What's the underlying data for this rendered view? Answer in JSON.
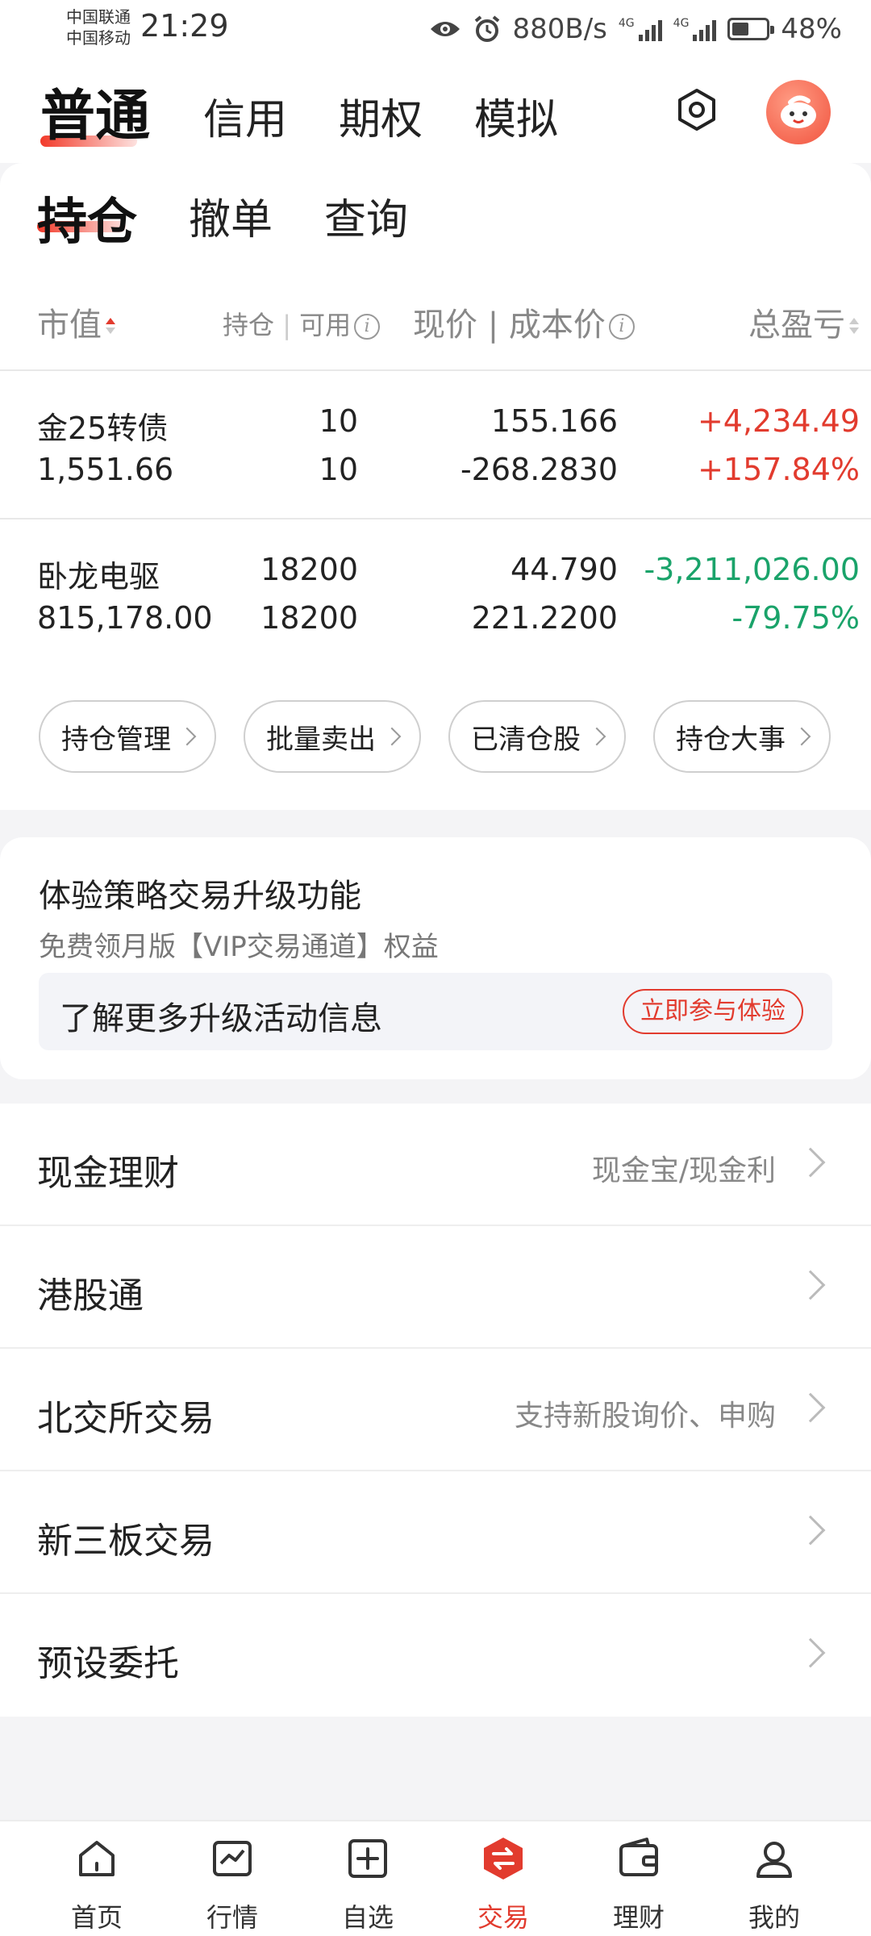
{
  "status_bar": {
    "carrier1": "中国联通",
    "carrier2": "中国移动",
    "time": "21:29",
    "net_speed": "880B/s",
    "network_type": "4G",
    "battery": "48%"
  },
  "top_tabs": [
    "普通",
    "信用",
    "期权",
    "模拟"
  ],
  "sub_tabs": [
    "持仓",
    "撤单",
    "查询"
  ],
  "headers": {
    "market_value": "市值",
    "holding": "持仓",
    "separator": "|",
    "available": "可用",
    "current_price": "现价",
    "cost_price": "成本价",
    "total_pl": "总盈亏"
  },
  "positions": [
    {
      "name": "金25转债",
      "market_value": "1,551.66",
      "holding": "10",
      "available": "10",
      "price": "155.166",
      "cost": "-268.2830",
      "pl": "+4,234.49",
      "pl_pct": "+157.84%",
      "trend": "up"
    },
    {
      "name": "卧龙电驱",
      "market_value": "815,178.00",
      "holding": "18200",
      "available": "18200",
      "price": "44.790",
      "cost": "221.2200",
      "pl": "-3,211,026.00",
      "pl_pct": "-79.75%",
      "trend": "down"
    }
  ],
  "action_chips": [
    "持仓管理",
    "批量卖出",
    "已清仓股",
    "持仓大事"
  ],
  "promo": {
    "title": "体验策略交易升级功能",
    "subtitle": "免费领月版【VIP交易通道】权益",
    "banner_text": "了解更多升级活动信息",
    "button": "立即参与体验"
  },
  "services": [
    {
      "name": "现金理财",
      "hint": "现金宝/现金利"
    },
    {
      "name": "港股通",
      "hint": ""
    },
    {
      "name": "北交所交易",
      "hint": "支持新股询价、申购"
    },
    {
      "name": "新三板交易",
      "hint": ""
    },
    {
      "name": "预设委托",
      "hint": ""
    }
  ],
  "bottom_nav": [
    "首页",
    "行情",
    "自选",
    "交易",
    "理财",
    "我的"
  ],
  "colors": {
    "accent": "#e23b2e",
    "up": "#e23b2e",
    "down": "#1aa36a"
  },
  "icons": {
    "status": [
      "eye-icon",
      "alarm-icon",
      "signal-icon",
      "battery-icon"
    ],
    "header": [
      "settings-hexagon-icon",
      "avatar-mascot"
    ],
    "nav": [
      "home-icon",
      "chart-icon",
      "add-square-icon",
      "trade-icon",
      "wallet-icon",
      "user-icon"
    ]
  }
}
